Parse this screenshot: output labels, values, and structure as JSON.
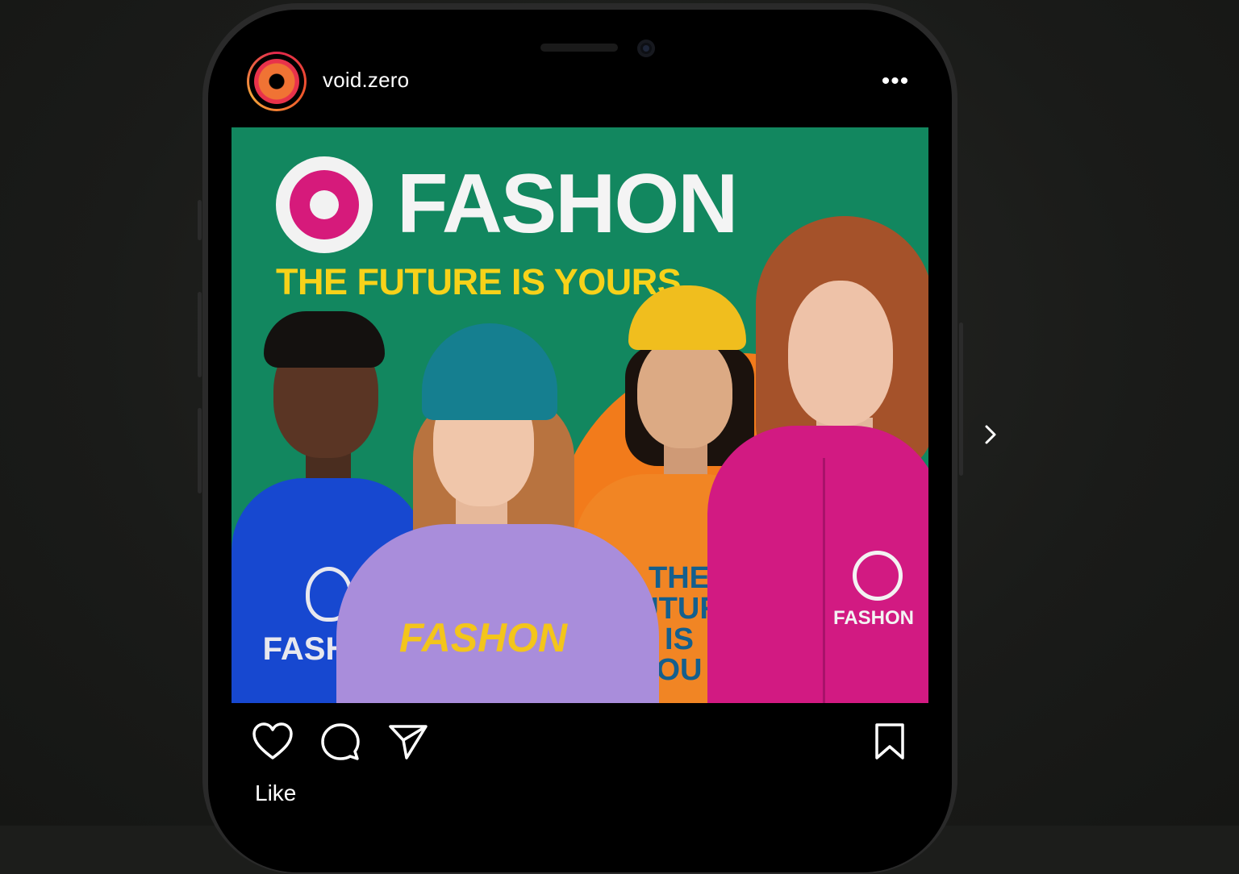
{
  "post": {
    "username": "void.zero",
    "more_glyph": "•••",
    "image": {
      "brand": "FASHON",
      "tagline": "THE FUTURE IS YOURS",
      "shirt_blue": "FASH",
      "shirt_purple": "FASHON",
      "shirt_orange_lines": [
        "THE",
        "UTUR",
        "IS",
        "OU"
      ],
      "hoodie_pink": "FASHON"
    },
    "actions": {
      "like_label": "Like",
      "like_icon": "heart-icon",
      "comment_icon": "comment-icon",
      "share_icon": "send-icon",
      "save_icon": "bookmark-icon"
    },
    "next_icon": "chevron-right-icon"
  },
  "colors": {
    "post_bg": "#12875f",
    "accent_pink": "#d61a7b",
    "tagline_yellow": "#f7d21a",
    "orange": "#f27b1b"
  }
}
